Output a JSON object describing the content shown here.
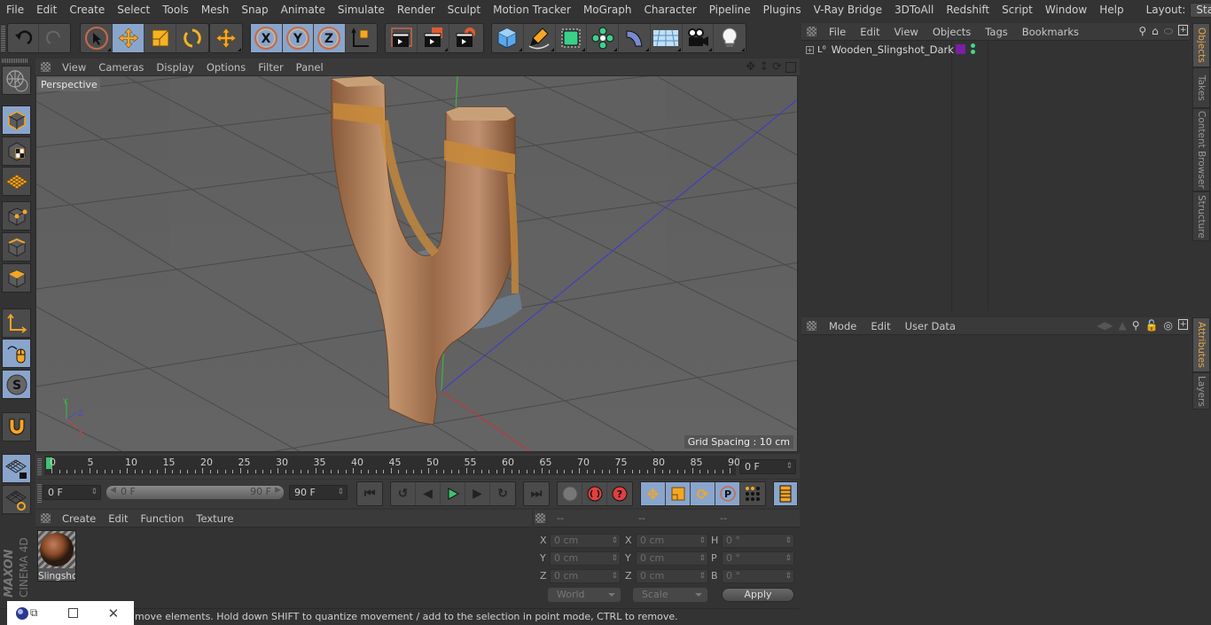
{
  "menubar": {
    "items": [
      "File",
      "Edit",
      "Create",
      "Select",
      "Tools",
      "Mesh",
      "Snap",
      "Animate",
      "Simulate",
      "Render",
      "Sculpt",
      "Motion Tracker",
      "MoGraph",
      "Character",
      "Pipeline",
      "Plugins",
      "V-Ray Bridge",
      "3DToAll",
      "Redshift",
      "Script",
      "Window",
      "Help"
    ],
    "layout_label": "Layout:",
    "layout_value": "Startup"
  },
  "toolbar": {
    "undo": "undo-icon",
    "redo": "redo-icon",
    "tools": [
      "live-selection",
      "move",
      "scale",
      "rotate",
      "last-tool"
    ],
    "axes": [
      "X",
      "Y",
      "Z"
    ],
    "coord_system": "world-coordinate-icon",
    "render": [
      "render-view",
      "render-to-picture-viewer",
      "render-settings"
    ],
    "objects": [
      "cube",
      "pen",
      "subdivision",
      "cloner",
      "deformer",
      "floor",
      "camera",
      "light"
    ]
  },
  "viewport": {
    "menu": [
      "View",
      "Cameras",
      "Display",
      "Options",
      "Filter",
      "Panel"
    ],
    "label": "Perspective",
    "grid_spacing": "Grid Spacing : 10 cm",
    "axis_labels": {
      "x": "X",
      "y": "Y",
      "z": "Z"
    }
  },
  "timeline": {
    "ticks": [
      "0",
      "5",
      "10",
      "15",
      "20",
      "25",
      "30",
      "35",
      "40",
      "45",
      "50",
      "55",
      "60",
      "65",
      "70",
      "75",
      "80",
      "85",
      "90"
    ],
    "current_frame_field": "0 F",
    "start_field": "0 F",
    "range_start": "0 F",
    "range_end": "90 F",
    "end_field": "90 F"
  },
  "materials": {
    "menu": [
      "Create",
      "Edit",
      "Function",
      "Texture"
    ],
    "items": [
      {
        "name": "Slingshc"
      }
    ]
  },
  "coordinates": {
    "headers": [
      "--",
      "--",
      "--"
    ],
    "rows": [
      {
        "l1": "X",
        "v1": "0 cm",
        "l2": "X",
        "v2": "0 cm",
        "l3": "H",
        "v3": "0 °"
      },
      {
        "l1": "Y",
        "v1": "0 cm",
        "l2": "Y",
        "v2": "0 cm",
        "l3": "P",
        "v3": "0 °"
      },
      {
        "l1": "Z",
        "v1": "0 cm",
        "l2": "Z",
        "v2": "0 cm",
        "l3": "B",
        "v3": "0 °"
      }
    ],
    "space_select": "World",
    "mode_select": "Scale",
    "apply": "Apply"
  },
  "status": {
    "text": "move elements. Hold down SHIFT to quantize movement / add to the selection in point mode, CTRL to remove."
  },
  "objects_panel": {
    "menu": [
      "File",
      "Edit",
      "View",
      "Objects",
      "Tags",
      "Bookmarks"
    ],
    "items": [
      {
        "name": "Wooden_Slingshot_Dark",
        "color": "#7a1fa2"
      }
    ]
  },
  "attributes_panel": {
    "menu": [
      "Mode",
      "Edit",
      "User Data"
    ]
  },
  "side_tabs": {
    "top": [
      "Objects",
      "Takes",
      "Content Browser",
      "Structure"
    ],
    "bottom": [
      "Attributes",
      "Layers"
    ]
  },
  "branding": "MAXON CINEMA 4D",
  "colors": {
    "accent": "#8aa5cc",
    "orange": "#f0a030",
    "active_tab": "#e8a64a"
  }
}
